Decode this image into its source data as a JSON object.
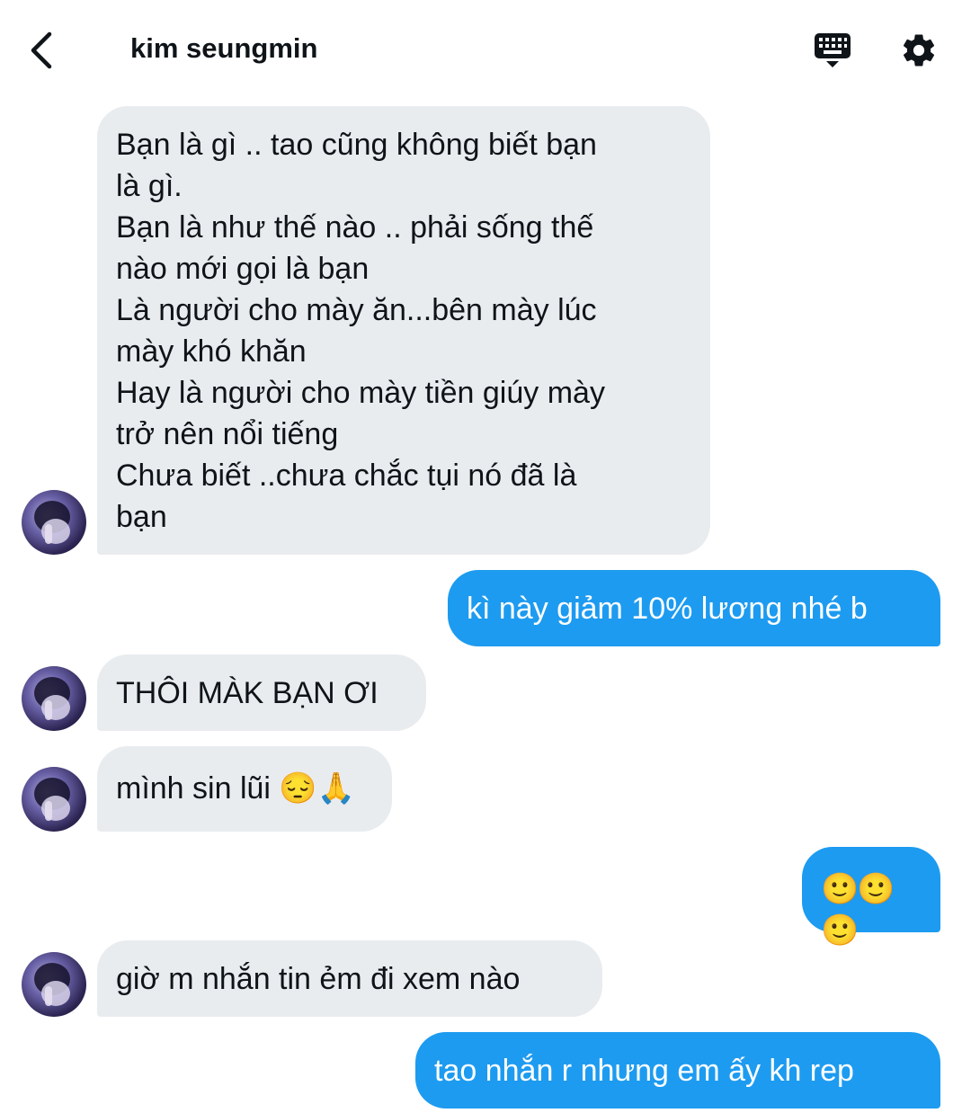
{
  "header": {
    "title": "kim seungmin",
    "back_icon": "chevron-left-icon",
    "keyboard_icon": "keyboard-icon",
    "settings_icon": "gear-icon"
  },
  "colors": {
    "incoming_bubble": "#e9ecef",
    "outgoing_bubble": "#1d9bf0",
    "text_dark": "#0f1419",
    "text_light": "#ffffff"
  },
  "messages": [
    {
      "direction": "incoming",
      "text": "Bạn là gì .. tao cũng không biết bạn\nlà gì.\nBạn là như thế nào .. phải sống thế\nnào mới gọi là bạn\nLà người cho mày ăn...bên mày lúc\nmày khó khăn\nHay là người cho mày tiền giúy mày\ntrở nên nổi tiếng\nChưa biết ..chưa chắc tụi nó đã là\nbạn"
    },
    {
      "direction": "outgoing",
      "text": "kì này giảm 10% lương nhé b"
    },
    {
      "direction": "incoming",
      "text": "THÔI MÀK BẠN ƠI"
    },
    {
      "direction": "incoming",
      "text": "mình sin lũi 😔🙏"
    },
    {
      "direction": "outgoing",
      "text": "🙂🙂🙂"
    },
    {
      "direction": "incoming",
      "text": "giờ m nhắn tin ẻm đi xem nào"
    },
    {
      "direction": "outgoing",
      "text": "tao nhắn r nhưng em ấy kh rep"
    }
  ]
}
